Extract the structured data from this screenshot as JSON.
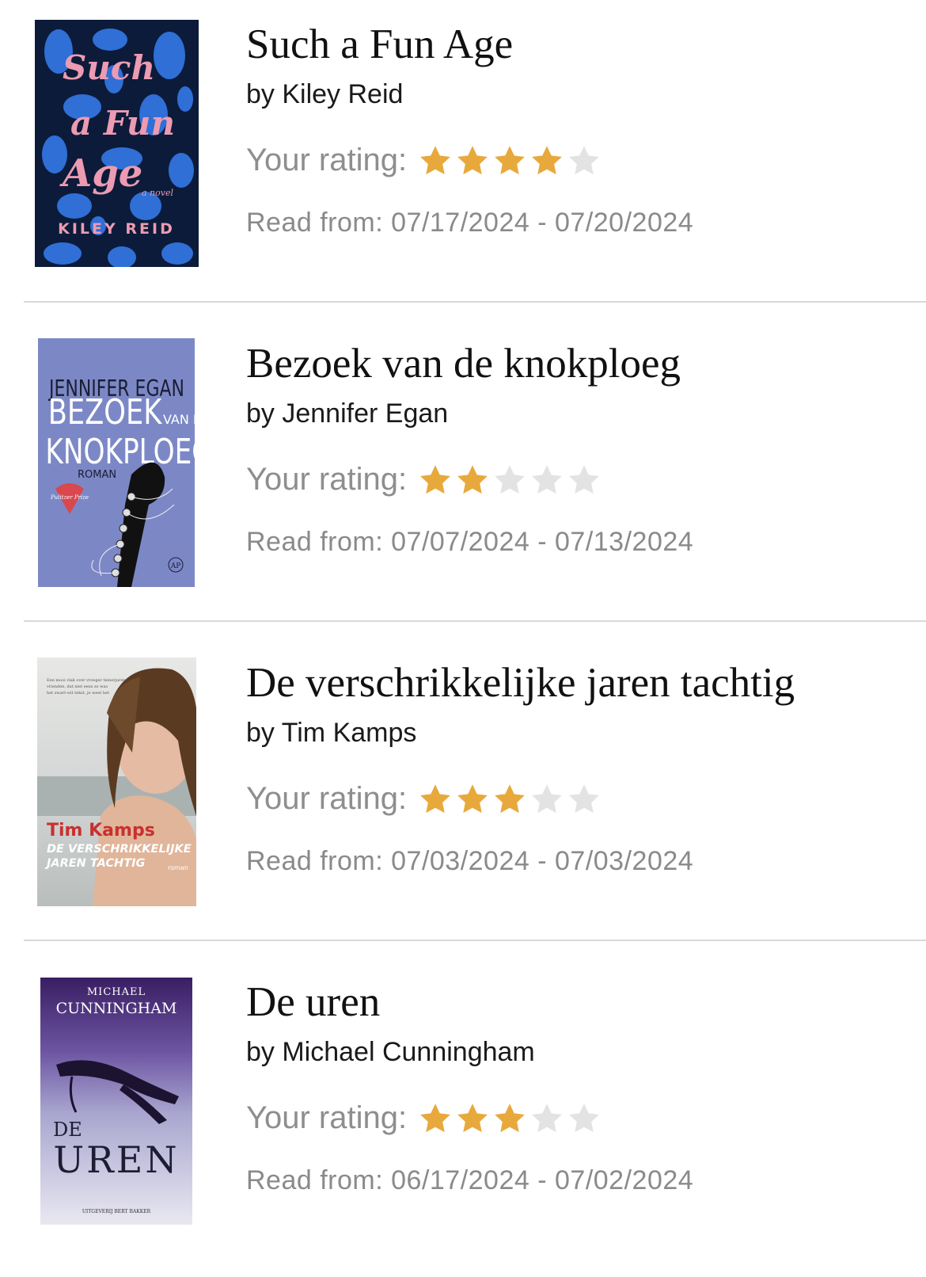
{
  "colors": {
    "star_filled": "#E8A93C",
    "star_empty": "#E3E3E3",
    "separator": "#D8D8D8"
  },
  "books": [
    {
      "title": "Such a Fun Age",
      "author": "by Kiley Reid",
      "rating_label": "Your rating:",
      "rating": 4,
      "max_rating": 5,
      "read_from": "Read from: 07/17/2024 - 07/20/2024",
      "cover": {
        "title_lines": [
          "Such",
          "a Fun",
          "Age"
        ],
        "tagline": "a novel",
        "author": "KILEY REID"
      }
    },
    {
      "title": "Bezoek van de knokploeg",
      "author": "by Jennifer Egan",
      "rating_label": "Your rating:",
      "rating": 2,
      "max_rating": 5,
      "read_from": "Read from: 07/07/2024 - 07/13/2024",
      "cover": {
        "author": "JENNIFER EGAN",
        "title_line1": "BEZOEK",
        "title_small": "VAN DE",
        "title_line2": "KNOKPLOEG",
        "subtitle": "ROMAN",
        "badge": "Pulitzer Prize 2011",
        "publisher": "AP"
      }
    },
    {
      "title": "De verschrikkelijke jaren tachtig",
      "author": "by Tim Kamps",
      "rating_label": "Your rating:",
      "rating": 3,
      "max_rating": 5,
      "read_from": "Read from: 07/03/2024 - 07/03/2024",
      "cover": {
        "author": "Tim Kamps",
        "title_line1": "DE VERSCHRIKKELIJKE",
        "title_line2": "JAREN TACHTIG",
        "subtitle": "roman"
      }
    },
    {
      "title": "De uren",
      "author": "by Michael Cunningham",
      "rating_label": "Your rating:",
      "rating": 3,
      "max_rating": 5,
      "read_from": "Read from: 06/17/2024 - 07/02/2024",
      "cover": {
        "author_first": "MICHAEL",
        "author_last": "CUNNINGHAM",
        "title_small": "DE",
        "title_big": "UREN",
        "publisher": "UITGEVERIJ BERT BAKKER"
      }
    }
  ]
}
